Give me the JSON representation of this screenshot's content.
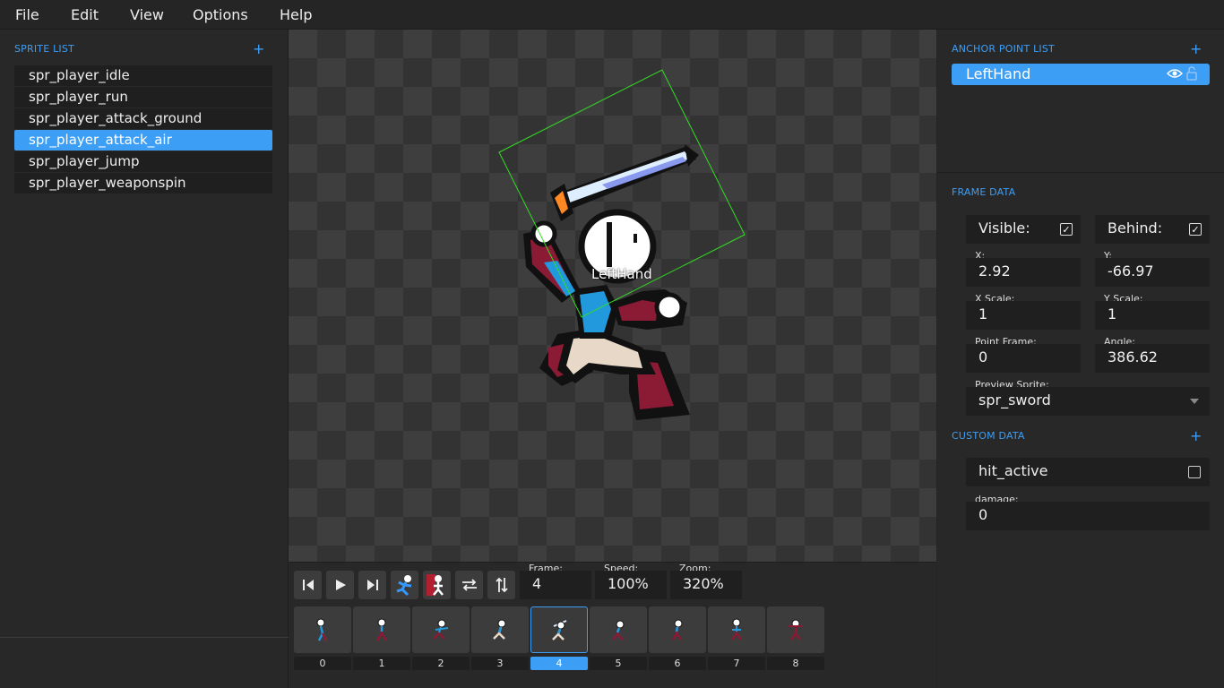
{
  "menu": {
    "file": "File",
    "edit": "Edit",
    "view": "View",
    "options": "Options",
    "help": "Help"
  },
  "sprite_list": {
    "title": "SPRITE LIST",
    "add": "+",
    "items": [
      "spr_player_idle",
      "spr_player_run",
      "spr_player_attack_ground",
      "spr_player_attack_air",
      "spr_player_jump",
      "spr_player_weaponspin"
    ],
    "selected_index": 3
  },
  "canvas": {
    "anchor_label": "LeftHand"
  },
  "playback": {
    "frame_label": "Frame:",
    "frame_value": "4",
    "speed_label": "Speed:",
    "speed_value": "100%",
    "zoom_label": "Zoom:",
    "zoom_value": "320%",
    "buttons": [
      "step-back-icon",
      "play-icon",
      "step-forward-icon",
      "running-figure-icon",
      "onion-skin-icon",
      "swap-horizontal-icon",
      "swap-vertical-icon"
    ]
  },
  "frames": {
    "numbers": [
      "0",
      "1",
      "2",
      "3",
      "4",
      "5",
      "6",
      "7",
      "8"
    ],
    "selected": 4
  },
  "anchor_list": {
    "title": "ANCHOR POINT LIST",
    "add": "+",
    "items": [
      {
        "name": "LeftHand",
        "visible": true,
        "locked": false
      }
    ]
  },
  "frame_data": {
    "title": "FRAME DATA",
    "visible_label": "Visible:",
    "visible": true,
    "behind_label": "Behind:",
    "behind": true,
    "x_label": "X:",
    "x": "2.92",
    "y_label": "Y:",
    "y": "-66.97",
    "xscale_label": "X Scale:",
    "xscale": "1",
    "yscale_label": "Y Scale:",
    "yscale": "1",
    "pointframe_label": "Point Frame:",
    "pointframe": "0",
    "angle_label": "Angle:",
    "angle": "386.62",
    "preview_label": "Preview Sprite:",
    "preview": "spr_sword"
  },
  "custom_data": {
    "title": "CUSTOM DATA",
    "add": "+",
    "hit_active_label": "hit_active",
    "hit_active": false,
    "damage_label": "damage:",
    "damage": "0"
  },
  "colors": {
    "accent": "#3d9ef5",
    "panel": "#282828",
    "field": "#1f1f1f",
    "bounding_box": "#33dd22"
  }
}
